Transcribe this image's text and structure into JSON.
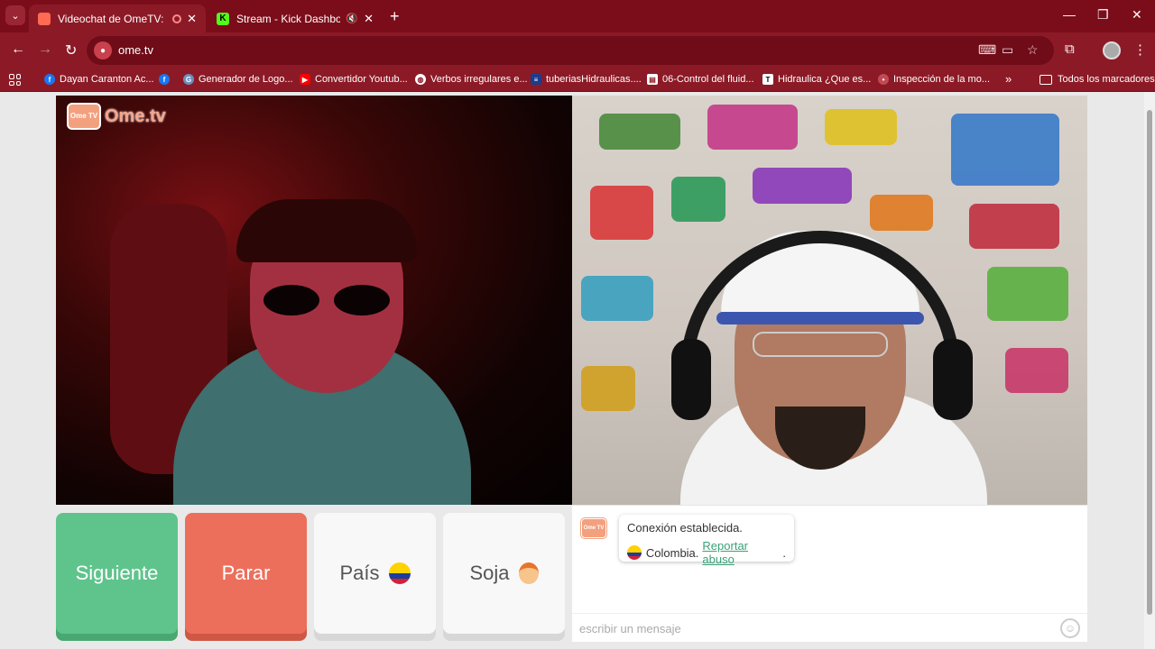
{
  "browser": {
    "tabs": [
      {
        "title": "Videochat de OmeTV: una al",
        "active": true
      },
      {
        "title": "Stream - Kick Dashboard",
        "active": false
      }
    ],
    "url": "ome.tv",
    "bookmarks": [
      "Dayan Caranton Ac...",
      "",
      "Generador de Logo...",
      "Convertidor Youtub...",
      "Verbos irregulares e...",
      "tuberiasHidraulicas....",
      "06-Control del fluid...",
      "Hidraulica ¿Que es...",
      "Inspección de la mo..."
    ],
    "bookmarks_more": "»",
    "all_bookmarks": "Todos los marcadores",
    "accent_color": "#8c1a26"
  },
  "site": {
    "logo_tv": "Ome TV",
    "logo_text": "Ome.tv"
  },
  "controls": {
    "next": "Siguiente",
    "stop": "Parar",
    "country": "País",
    "gender": "Soja"
  },
  "chat": {
    "logo": "Ome TV",
    "message": "Conexión establecida.",
    "country": "Colombia",
    "separator": " .",
    "report": "Reportar abuso",
    "report_end": ".",
    "input_placeholder": "escribir un mensaje"
  }
}
